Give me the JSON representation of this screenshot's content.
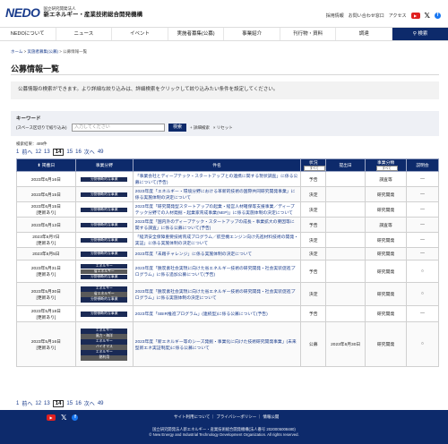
{
  "header": {
    "logo_mark": "NEDO",
    "org_sub": "国立研究開発法人",
    "org_name": "新エネルギー・産業技術総合開発機構",
    "utility": [
      "採用情報",
      "お問い合わせ窓口",
      "アクセス"
    ],
    "icons": [
      "youtube-icon",
      "x-icon",
      "facebook-icon"
    ]
  },
  "nav": {
    "items": [
      "NEDOについて",
      "ニュース",
      "イベント",
      "実施者募集(公募)",
      "事業紹介",
      "刊行物・資料",
      "調達"
    ],
    "search": "検索"
  },
  "breadcrumb": [
    "ホーム",
    "実施者募集(公募)",
    "公募情報一覧"
  ],
  "page_title": "公募情報一覧",
  "info_text": "公募情報の検索ができます。より詳細な絞り込みは、詳細検索をクリックして絞り込みたい条件を設定してください。",
  "keyword": {
    "title": "キーワード",
    "label": "(スペース区切りで絞り込み)",
    "placeholder": "入力してください",
    "search_button": "検索",
    "detail_link": "+ 詳細検索",
    "reset_link": "× リセット"
  },
  "result_count": "検索結果：489件",
  "pager": {
    "first": "1",
    "prev": "前へ",
    "pages": [
      "12",
      "13",
      "14",
      "15",
      "16"
    ],
    "current": "14",
    "next": "次へ",
    "last": "49"
  },
  "table": {
    "headers": [
      "掲載日",
      "事業分野",
      "件名",
      "状況",
      "提出日",
      "事業分類",
      "説明会"
    ],
    "filter_all": "すべて",
    "rows": [
      {
        "date": "2023年6月16日",
        "updated": "",
        "fields": [
          "分野横断的な事業"
        ],
        "name": "「事業会社とディープテック・スタートアップとの連携に関する現状調査」に係る公募について(予告)",
        "status": "予告",
        "submit": "",
        "category": "調査等",
        "briefing": "—"
      },
      {
        "date": "2023年6月15日",
        "updated": "",
        "fields": [
          "分野横断的な事業"
        ],
        "name": "2023年度「エネルギー・環境分野における革新的技術の国際共同研究開発事業」に係る実施体制の決定について",
        "status": "決定",
        "submit": "",
        "category": "研究開発",
        "briefing": "—"
      },
      {
        "date": "2023年6月15日",
        "updated": "[更新あり]",
        "fields": [
          "分野横断的な事業"
        ],
        "name": "2023年度「研究開発型スタートアップの起業・経営人材確保等支援事業／ディープテック分野での人材発掘・起業家育成事業(NEP)」に係る実施体制の決定について",
        "status": "決定",
        "submit": "",
        "category": "研究開発",
        "briefing": "—"
      },
      {
        "date": "2023年6月13日",
        "updated": "",
        "fields": [
          "分野横断的な事業"
        ],
        "name": "2023年度「国内外のディープテック・スタートアップの成長・事業拡大の要因等に関する調査」に係る公募について(予告)",
        "status": "予告",
        "submit": "",
        "category": "調査等",
        "briefing": "—"
      },
      {
        "date": "2023年6月7日",
        "updated": "[更新あり]",
        "fields": [
          "分野横断的な事業"
        ],
        "name": "「経済安全保障重要技術育成プログラム／航空機エンジン向け先進材料技術の開発・実証」に係る実施体制の決定について",
        "status": "決定",
        "submit": "",
        "category": "研究開発",
        "briefing": "—"
      },
      {
        "date": "2023年6月5日",
        "updated": "",
        "fields": [
          "分野横断的な事業"
        ],
        "name": "2023年度「未踏チャレンジ」に係る実施体制の決定について",
        "status": "決定",
        "submit": "",
        "category": "研究開発",
        "briefing": "—"
      },
      {
        "date": "2023年5月31日",
        "updated": "[更新あり]",
        "fields": [
          "エネルギー",
          "省エネルギー",
          "分野横断的な事業"
        ],
        "name": "2023年度「脱炭素社会実現に向けた省エネルギー技術の研究開発・社会実装促進プログラム」に係る追加公募について(予告)",
        "status": "予告",
        "submit": "",
        "category": "研究開発",
        "briefing": "○"
      },
      {
        "date": "2023年5月30日",
        "updated": "[更新あり]",
        "fields": [
          "エネルギー",
          "省エネルギー",
          "分野横断的な事業"
        ],
        "name": "2023年度「脱炭素社会実現に向けた省エネルギー技術の研究開発・社会実装促進プログラム」に係る実施体制の決定について",
        "status": "決定",
        "submit": "",
        "category": "研究開発",
        "briefing": "○"
      },
      {
        "date": "2023年5月18日",
        "updated": "[更新あり]",
        "fields": [
          "分野横断的な事業"
        ],
        "name": "2023年度「SBIR推進プログラム」(連続型)に係る公募について(予告)",
        "status": "予告",
        "submit": "",
        "category": "研究開発",
        "briefing": "—"
      },
      {
        "date": "2023年5月16日",
        "updated": "[更新あり]",
        "fields": [
          "エネルギー",
          "風力・海洋",
          "エネルギー",
          "バイオマス",
          "エネルギー",
          "熱利用"
        ],
        "name": "2023年度「新エネルギー等のシーズ発掘・事業化に向けた技術研究開発事業」(未来型新エネ実証制度)に係る公募について",
        "status": "公募",
        "submit": "2023年6月30日",
        "category": "研究開発",
        "briefing": "○"
      }
    ]
  },
  "footer": {
    "links": [
      "サイト利用について",
      "プライバシーポリシー",
      "情報公開"
    ],
    "address": "国立研究開発法人新エネルギー・産業技術総合開発機構(法人番号 2020005008480)",
    "copyright": "© New Energy and Industrial Technology Development Organization. All rights reserved."
  },
  "colors": {
    "brand": "#0d2a6b",
    "link": "#1a3c8c"
  }
}
